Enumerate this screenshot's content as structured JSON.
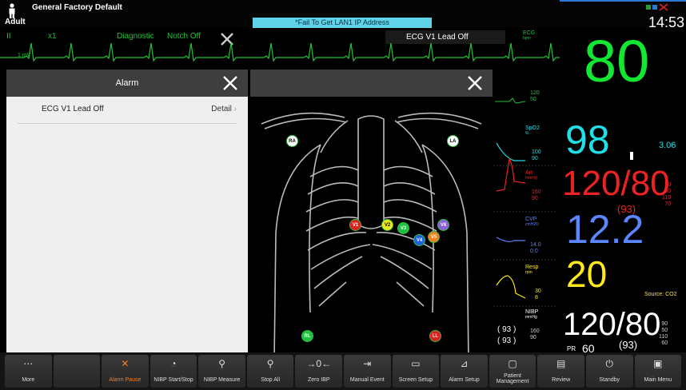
{
  "topbar": {
    "patient_type": "Adult",
    "profile": "General Factory Default",
    "network_message": "*Fail To Get LAN1 IP Address",
    "time": "14:53"
  },
  "ecg": {
    "lead": "II",
    "gain": "x1",
    "mode": "Diagnostic",
    "notch": "Notch Off",
    "scale": "1 mV",
    "alarm_message": "ECG V1 Lead Off",
    "label": "ECG",
    "unit": "bpm"
  },
  "alarm_panel": {
    "title": "Alarm",
    "alarms": [
      {
        "message": "ECG V1 Lead Off",
        "action": "Detail"
      }
    ]
  },
  "lead_diagram": {
    "electrodes": [
      {
        "label": "RA",
        "color": "#ffffff",
        "text": "#000000"
      },
      {
        "label": "LA",
        "color": "#ffffff",
        "text": "#000000"
      },
      {
        "label": "V1",
        "color": "#e02020",
        "text": "#ffffff"
      },
      {
        "label": "V2",
        "color": "#e8e820",
        "text": "#000000"
      },
      {
        "label": "V3",
        "color": "#20c040",
        "text": "#ffffff"
      },
      {
        "label": "V4",
        "color": "#2060e0",
        "text": "#ffffff"
      },
      {
        "label": "V5",
        "color": "#f08020",
        "text": "#ffffff"
      },
      {
        "label": "V6",
        "color": "#8a60d8",
        "text": "#ffffff"
      },
      {
        "label": "RL",
        "color": "#20c040",
        "text": "#ffffff"
      },
      {
        "label": "LL",
        "color": "#e02020",
        "text": "#ffffff"
      }
    ]
  },
  "vitals": {
    "hr": {
      "value": "80",
      "limits": [
        "120",
        "50"
      ]
    },
    "spo2": {
      "label": "SpO2",
      "unit": "%",
      "value": "98",
      "limits": [
        "100",
        "90"
      ],
      "side": "3.06"
    },
    "art": {
      "label": "Art",
      "unit": "mmHg",
      "value": "120/80",
      "mean": "(93)",
      "limits": [
        "160",
        "90"
      ],
      "side": [
        "90",
        "50",
        "110",
        "70"
      ]
    },
    "cvp": {
      "label": "CVP",
      "unit": "cmH2O",
      "value": "12.2",
      "limits": [
        "14.0",
        "0.0"
      ]
    },
    "resp": {
      "label": "Resp",
      "unit": "rpm",
      "value": "20",
      "limits": [
        "30",
        "8"
      ],
      "source": "Source: CO2"
    },
    "nibp": {
      "label": "NIBP",
      "unit": "mmHg",
      "value": "120/80",
      "mean": "(93)",
      "pr_label": "PR",
      "pr": "60",
      "limits": [
        "160",
        "90"
      ],
      "side": [
        "90",
        "50",
        "110",
        "60"
      ],
      "paren1": "( 93 )",
      "paren2": "( 93 )"
    }
  },
  "toolbar": [
    {
      "label": "More",
      "icon": "⋯",
      "active": false
    },
    {
      "label": "",
      "icon": "",
      "active": false
    },
    {
      "label": "Alarm Pause",
      "icon": "✕",
      "active": true
    },
    {
      "label": "NIBP Start/Stop",
      "icon": "◔",
      "active": false
    },
    {
      "label": "NIBP Measure",
      "icon": "⚲",
      "active": false
    },
    {
      "label": "Stop All",
      "icon": "⚲",
      "active": false
    },
    {
      "label": "Zero IBP",
      "icon": "→0←",
      "active": false
    },
    {
      "label": "Manual Event",
      "icon": "⇥",
      "active": false
    },
    {
      "label": "Screen Setup",
      "icon": "▭",
      "active": false
    },
    {
      "label": "Alarm Setup",
      "icon": "⊿",
      "active": false
    },
    {
      "label": "Patient Management",
      "icon": "▢",
      "active": false
    },
    {
      "label": "Review",
      "icon": "▤",
      "active": false
    },
    {
      "label": "Standby",
      "icon": "⏻",
      "active": false
    },
    {
      "label": "Main Menu",
      "icon": "▣",
      "active": false
    }
  ]
}
